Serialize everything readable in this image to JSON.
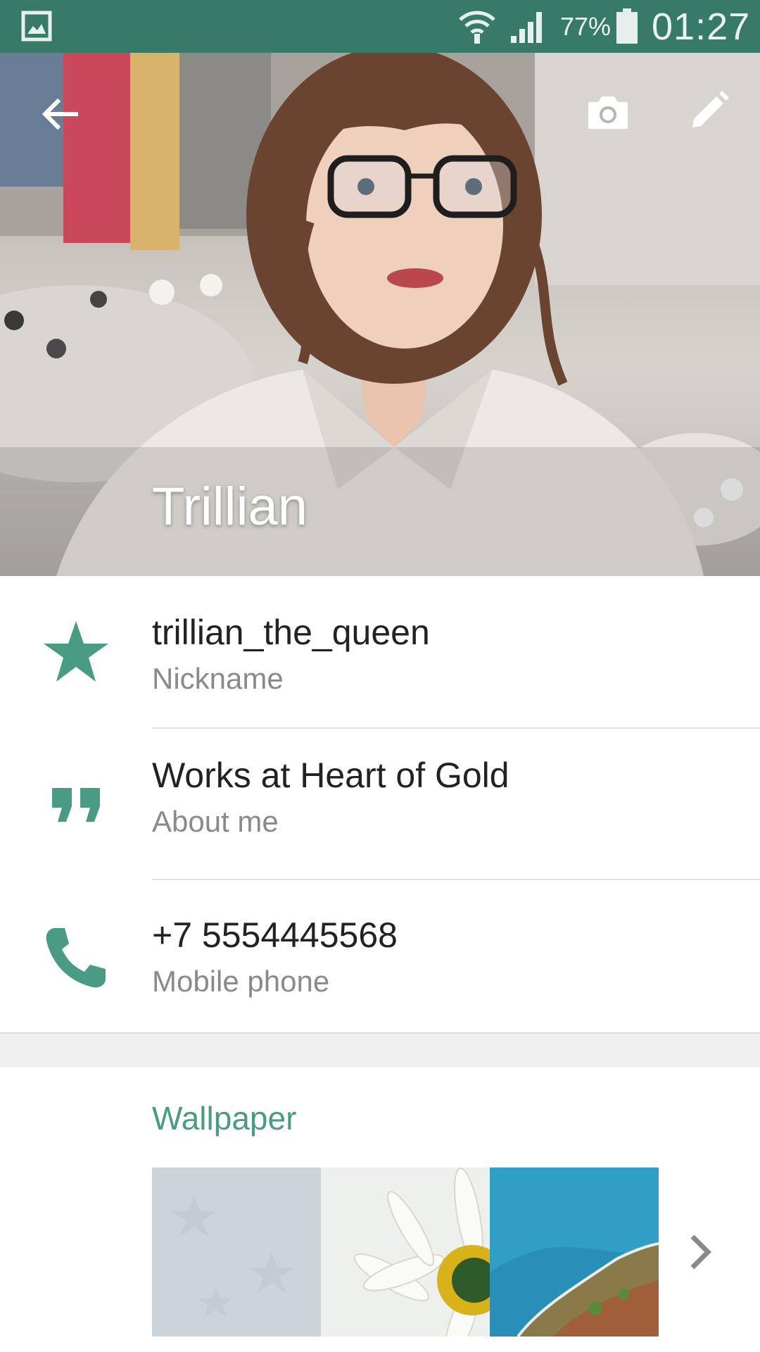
{
  "status_bar": {
    "battery_percent": "77%",
    "time": "01:27",
    "icons": [
      "gallery-icon",
      "wifi-icon",
      "signal-icon",
      "battery-icon"
    ]
  },
  "header": {
    "contact_name": "Trillian",
    "icons": [
      "back-arrow-icon",
      "camera-icon",
      "pencil-icon"
    ]
  },
  "info": {
    "nickname": {
      "value": "trillian_the_queen",
      "label": "Nickname",
      "icon": "star-icon"
    },
    "about": {
      "value": "Works at Heart of Gold",
      "label": "About me",
      "icon": "quote-icon"
    },
    "phone": {
      "value": "+7 5554445568",
      "label": "Mobile phone",
      "icon": "phone-icon"
    }
  },
  "wallpaper": {
    "title": "Wallpaper",
    "thumbnails": [
      "pattern",
      "daisy",
      "coastline"
    ],
    "more_icon": "chevron-right-icon"
  },
  "colors": {
    "status_bar": "#377a67",
    "accent": "#4a9b83",
    "primary_text": "#222222",
    "secondary_text": "#8a8a8a"
  }
}
